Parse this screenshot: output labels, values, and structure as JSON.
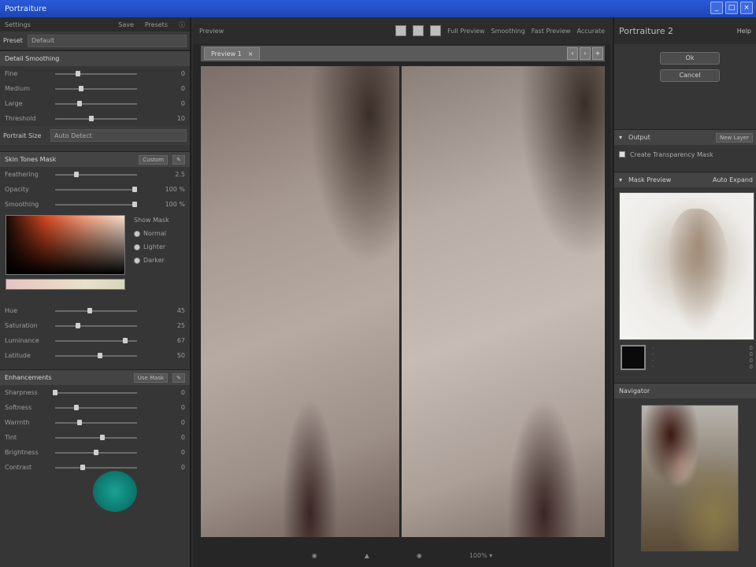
{
  "window": {
    "title": "Portraiture",
    "controls": [
      "_",
      "□",
      "×"
    ]
  },
  "left_panel": {
    "tabs": [
      "Settings",
      "Save",
      "Presets",
      "ⓘ"
    ],
    "preset_label": "Preset",
    "preset_value": "Default",
    "detail_section": {
      "title": "Detail Smoothing",
      "sliders": [
        {
          "label": "Fine",
          "value": "0",
          "level": 0.28
        },
        {
          "label": "Medium",
          "value": "0",
          "level": 0.32
        },
        {
          "label": "Large",
          "value": "0",
          "level": 0.3
        },
        {
          "label": "Threshold",
          "value": "10",
          "level": 0.44
        }
      ],
      "size_label": "Portrait Size",
      "size_value": "Auto Detect"
    },
    "mask_section": {
      "title": "Skin Tones Mask",
      "mode": "Custom",
      "sliders": [
        {
          "label": "Feathering",
          "value": "2.5",
          "level": 0.26
        },
        {
          "label": "Opacity",
          "value": "100 %",
          "level": 0.97
        },
        {
          "label": "Smoothing",
          "value": "100 %",
          "level": 0.97
        }
      ],
      "mask_radios": [
        "Normal",
        "Lighter",
        "Darker"
      ],
      "mask_heading": "Show Mask",
      "tone_sliders": [
        {
          "label": "Hue",
          "value": "45",
          "level": 0.42
        },
        {
          "label": "Saturation",
          "value": "25",
          "level": 0.28
        },
        {
          "label": "Luminance",
          "value": "67",
          "level": 0.86
        },
        {
          "label": "Latitude",
          "value": "50",
          "level": 0.55
        }
      ]
    },
    "enhance_section": {
      "title": "Enhancements",
      "toggle": "Use Mask",
      "sliders": [
        {
          "label": "Sharpness",
          "value": "0",
          "level": 0.0
        },
        {
          "label": "Softness",
          "value": "0",
          "level": 0.26
        },
        {
          "label": "Warmth",
          "value": "0",
          "level": 0.3
        },
        {
          "label": "Tint",
          "value": "0",
          "level": 0.58
        },
        {
          "label": "Brightness",
          "value": "0",
          "level": 0.5
        },
        {
          "label": "Contrast",
          "value": "0",
          "level": 0.34
        }
      ]
    }
  },
  "center_panel": {
    "title": "Preview",
    "options": [
      "Full Preview",
      "Smoothing",
      "Fast Preview",
      "Accurate"
    ],
    "tab_label": "Preview 1",
    "statusbar": [
      "◉",
      "▲",
      "◉",
      "100% ▾"
    ]
  },
  "right_panel": {
    "brand": "Portraiture",
    "brand_version": "2",
    "help_label": "Help",
    "ok_button": "Ok",
    "cancel_button": "Cancel",
    "output_section": "Output",
    "output_value": "New Layer",
    "checkbox_label": "Create Transparency Mask",
    "mask_preview_title": "Mask Preview",
    "mask_preview_toggle": "Auto Expand",
    "mini_values": [
      "0",
      "0",
      "0",
      "0"
    ],
    "navigator_title": "Navigator"
  }
}
